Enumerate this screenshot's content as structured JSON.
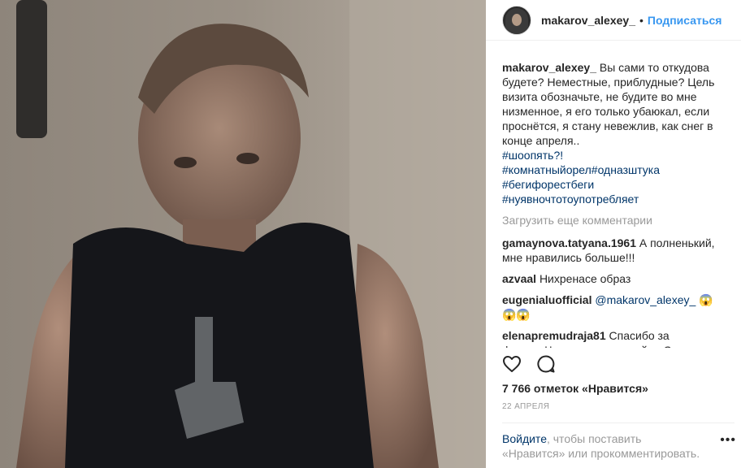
{
  "header": {
    "username": "makarov_alexey_",
    "separator": "•",
    "follow_label": "Подписаться"
  },
  "caption": {
    "username": "makarov_alexey_",
    "text": "Вы сами то откудова будете? Неместные, приблудные? Цель визита обозначьте, не будите во мне низменное, я его только убаюкал, если проснётся, я стану невежлив, как снег в конце апреля..",
    "hashtags": [
      "#шоопять?!",
      "#комнатныйорел#одназштука",
      "#бегифорестбеги",
      "#нуявночтотоупотребляет"
    ]
  },
  "load_more_label": "Загрузить еще комментарии",
  "comments": [
    {
      "username": "gamaynova.tatyana.1961",
      "text": "А полненький, мне нравились больше!!!"
    },
    {
      "username": "azvaal",
      "text": "Нихренасе образ"
    },
    {
      "username": "eugenialuofficial",
      "mention": "@makarov_alexey_",
      "text": "😱😱😱"
    },
    {
      "username": "elenapremudraja81",
      "text": "Спасибо за фильм«Частица вселенной».. Смотрела сразу две серии, после окончания"
    }
  ],
  "likes_text": "7 766 отметок «Нравится»",
  "date_text": "22 АПРЕЛЯ",
  "login": {
    "link": "Войдите",
    "text": ", чтобы поставить «Нравится» или прокомментировать."
  },
  "more_label": "•••",
  "icons": {
    "like": "heart-icon",
    "comment": "comment-icon",
    "more": "more-options-icon"
  },
  "colors": {
    "accent": "#3897f0",
    "link": "#003569",
    "muted": "#999999",
    "text": "#262626"
  }
}
